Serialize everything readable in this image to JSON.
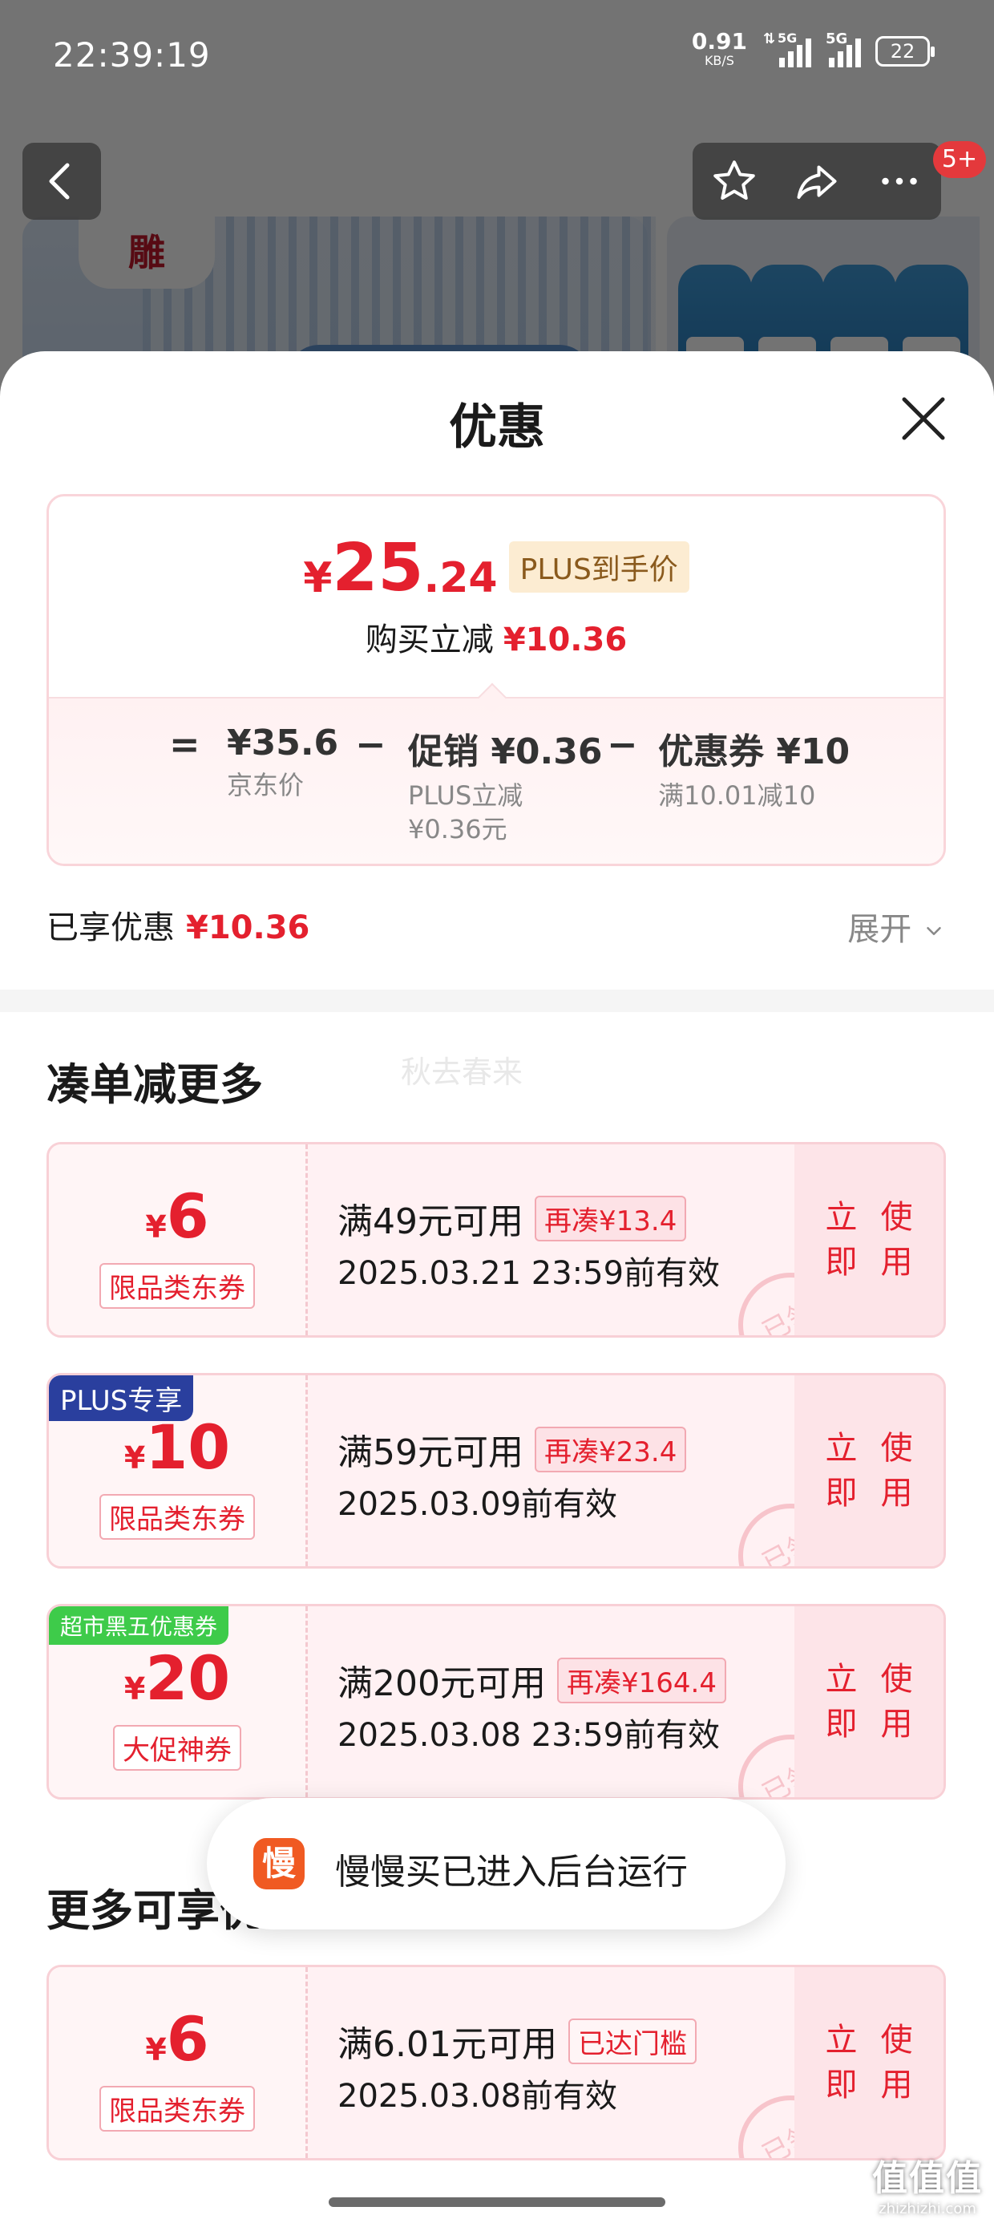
{
  "status_bar": {
    "time": "22:39:19",
    "net_speed": "0.91",
    "net_unit": "KB/S",
    "sig1": "5G",
    "sig2": "5G",
    "battery": "22"
  },
  "nav": {
    "back_icon": "chevron-left-icon",
    "star_icon": "star-icon",
    "share_icon": "share-icon",
    "more_icon": "more-icon",
    "badge": "5+"
  },
  "background": {
    "logo_text": "雕"
  },
  "sheet": {
    "title": "优惠",
    "close_icon": "close-icon",
    "summary": {
      "price_currency": "¥",
      "price_int": "25",
      "price_dec": ".24",
      "price_tag": "PLUS到手价",
      "reduce_label": "购买立减",
      "reduce_value": "¥10.36",
      "eq": "=",
      "minus": "−",
      "jd_price": "¥35.6",
      "jd_label": "京东价",
      "promo_value": "促销 ¥0.36",
      "promo_desc1": "PLUS立减",
      "promo_desc2": "¥0.36元",
      "coupon_value": "优惠券 ¥10",
      "coupon_desc": "满10.01减10"
    },
    "enjoyed_label": "已享优惠",
    "enjoyed_value": "¥10.36",
    "expand_label": "展开",
    "section1_title": "凑单减更多",
    "watermark": "秋去春来",
    "coupons": [
      {
        "currency": "¥",
        "amount": "6",
        "type": "限品类东券",
        "condition": "满49元可用",
        "tag": "再凑¥13.4",
        "expire": "2025.03.21 23:59前有效",
        "action": "立即使用",
        "stamp": "已领"
      },
      {
        "corner": "PLUS专享",
        "currency": "¥",
        "amount": "10",
        "type": "限品类东券",
        "condition": "满59元可用",
        "tag": "再凑¥23.4",
        "expire": "2025.03.09前有效",
        "action": "立即使用",
        "stamp": "已领"
      },
      {
        "corner": "超市黑五优惠券",
        "currency": "¥",
        "amount": "20",
        "type": "大促神券",
        "condition": "满200元可用",
        "tag": "再凑¥164.4",
        "expire": "2025.03.08 23:59前有效",
        "action": "立即使用",
        "stamp": "已领"
      },
      {
        "currency": "¥",
        "amount": "6",
        "type": "限品类东券",
        "condition": "满6.01元可用",
        "tag": "已达门槛",
        "expire": "2025.03.08前有效",
        "action": "立即使用",
        "stamp": "已领"
      }
    ],
    "section2_title": "更多可享优惠"
  },
  "toast": {
    "icon_char": "慢",
    "text": "慢慢买已进入后台运行"
  },
  "site_mark": {
    "big": "值值值",
    "small": "zhizhizhi.com"
  }
}
